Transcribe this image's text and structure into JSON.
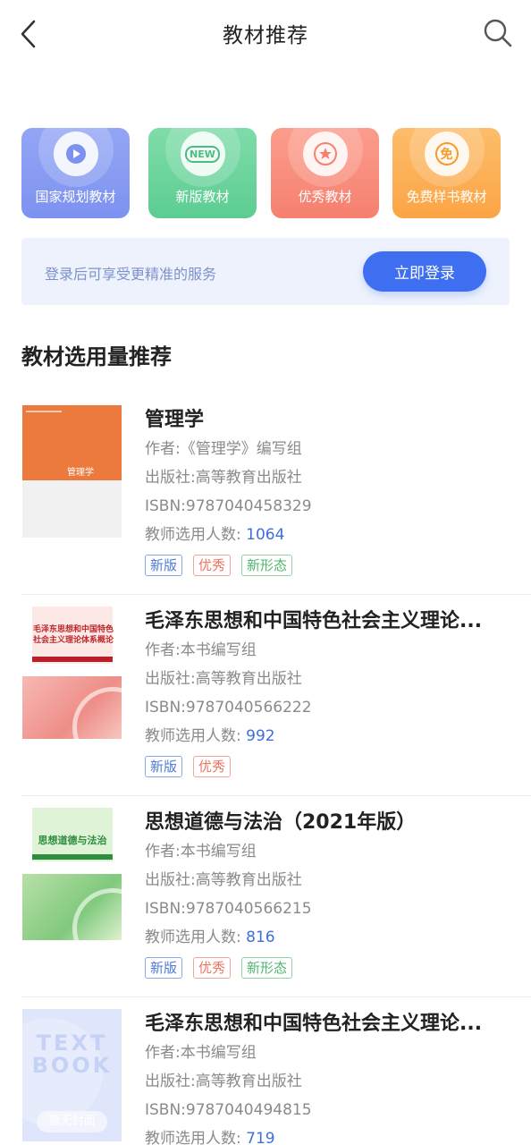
{
  "navbar": {
    "title": "教材推荐",
    "back_icon": "chevron-left-icon",
    "search_icon": "search-icon"
  },
  "categories": [
    {
      "label": "国家规划教材",
      "icon": "play-icon",
      "color": "#7d92f0"
    },
    {
      "label": "新版教材",
      "icon": "new-icon",
      "badge_text": "NEW",
      "color": "#5ccd92"
    },
    {
      "label": "优秀教材",
      "icon": "star-icon",
      "color": "#f6806f"
    },
    {
      "label": "免费样书教材",
      "icon": "free-icon",
      "badge_text": "免",
      "color": "#fca445"
    }
  ],
  "login_bar": {
    "tip": "登录后可享受更精准的服务",
    "button_label": "立即登录"
  },
  "section_title": "教材选用量推荐",
  "books": [
    {
      "title": "管理学",
      "author": "作者:《管理学》编写组",
      "publisher": "出版社:高等教育出版社",
      "isbn": "ISBN:9787040458329",
      "count_label": "教师选用人数: ",
      "count": "1064",
      "tags": [
        "新版",
        "优秀",
        "新形态"
      ],
      "cover_text": "管理学"
    },
    {
      "title": "毛泽东思想和中国特色社会主义理论...",
      "author": "作者:本书编写组",
      "publisher": "出版社:高等教育出版社",
      "isbn": "ISBN:9787040566222",
      "count_label": "教师选用人数: ",
      "count": "992",
      "tags": [
        "新版",
        "优秀"
      ],
      "cover_text": "毛泽东思想和中国特色社会主义理论体系概论"
    },
    {
      "title": "思想道德与法治（2021年版）",
      "author": "作者:本书编写组",
      "publisher": "出版社:高等教育出版社",
      "isbn": "ISBN:9787040566215",
      "count_label": "教师选用人数: ",
      "count": "816",
      "tags": [
        "新版",
        "优秀",
        "新形态"
      ],
      "cover_text": "思想道德与法治"
    },
    {
      "title": "毛泽东思想和中国特色社会主义理论...",
      "author": "作者:本书编写组",
      "publisher": "出版社:高等教育出版社",
      "isbn": "ISBN:9787040494815",
      "count_label": "教师选用人数: ",
      "count": "719",
      "tags": [],
      "cover_text_line1": "TEXT",
      "cover_text_line2": "BOOK",
      "cover_placeholder": "暂无封面"
    }
  ],
  "tag_classes": {
    "新版": "tag-new",
    "优秀": "tag-excellent",
    "新形态": "tag-form"
  }
}
